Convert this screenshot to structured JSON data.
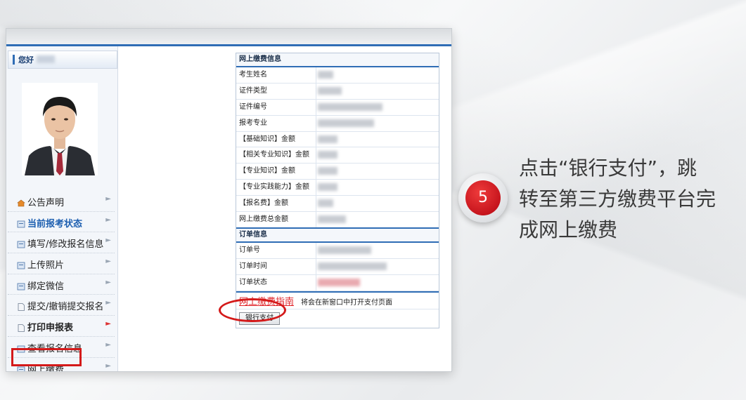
{
  "sidebar": {
    "greeting": "您好",
    "items": [
      {
        "label": "公告声明",
        "icon": "house-icon",
        "style": "normal"
      },
      {
        "label": "当前报考状态",
        "icon": "document-icon",
        "style": "blue"
      },
      {
        "label": "填写/修改报名信息",
        "icon": "document-icon",
        "style": "normal"
      },
      {
        "label": "上传照片",
        "icon": "document-icon",
        "style": "normal"
      },
      {
        "label": "绑定微信",
        "icon": "document-icon",
        "style": "normal"
      },
      {
        "label": "提交/撤销提交报名",
        "icon": "page-icon",
        "style": "normal"
      },
      {
        "label": "打印申报表",
        "icon": "page-icon",
        "style": "bold"
      },
      {
        "label": "查看报名信息",
        "icon": "document-icon",
        "style": "normal"
      },
      {
        "label": "网上缴费",
        "icon": "document-icon",
        "style": "normal"
      }
    ]
  },
  "payment": {
    "section_title": "网上缴费信息",
    "rows": [
      {
        "label": "考生姓名"
      },
      {
        "label": "证件类型"
      },
      {
        "label": "证件编号"
      },
      {
        "label": "报考专业"
      },
      {
        "label": "【基础知识】金额"
      },
      {
        "label": "【相关专业知识】金额"
      },
      {
        "label": "【专业知识】金额"
      },
      {
        "label": "【专业实践能力】金额"
      },
      {
        "label": "【报名费】金额"
      },
      {
        "label": "网上缴费总金额"
      }
    ]
  },
  "order": {
    "section_title": "订单信息",
    "rows": [
      {
        "label": "订单号"
      },
      {
        "label": "订单时间"
      },
      {
        "label": "订单状态"
      }
    ]
  },
  "guide": {
    "link_text": "网上缴费指南",
    "note": "将会在新窗口中打开支付页面"
  },
  "bank_pay_button": "银行支付",
  "step": {
    "number": "5",
    "caption_lines": [
      "点击“银行支付”，跳",
      "转至第三方缴费平台完",
      "成网上缴费"
    ]
  },
  "colors": {
    "accent_blue": "#2f6db5",
    "highlight_red": "#d41a1a",
    "badge_red": "#c3121b"
  }
}
